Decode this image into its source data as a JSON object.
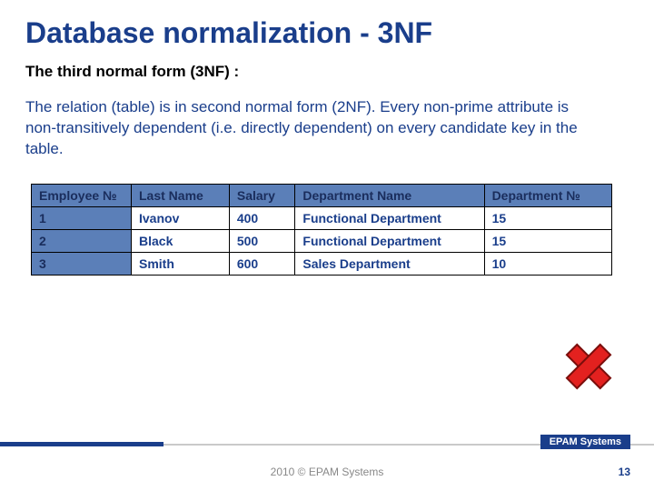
{
  "title": "Database normalization - 3NF",
  "subtitle": "The third normal form (3NF) :",
  "body": "The relation (table) is in second normal form (2NF). Every non-prime attribute is non-transitively dependent (i.e. directly dependent) on every candidate key in the table.",
  "table": {
    "headers": [
      "Employee №",
      "Last Name",
      "Salary",
      "Department Name",
      "Department №"
    ],
    "rows": [
      [
        "1",
        "Ivanov",
        "400",
        "Functional Department",
        "15"
      ],
      [
        "2",
        "Black",
        "500",
        "Functional Department",
        "15"
      ],
      [
        "3",
        "Smith",
        "600",
        "Sales Department",
        "10"
      ]
    ]
  },
  "footer": {
    "badge": "EPAM Systems",
    "copyright": "2010 © EPAM Systems",
    "page": "13"
  },
  "icons": {
    "cross": "cross-icon"
  },
  "colors": {
    "brand_blue": "#1a3e8b",
    "header_fill": "#5b7fb8",
    "cross_red": "#e3211f"
  }
}
